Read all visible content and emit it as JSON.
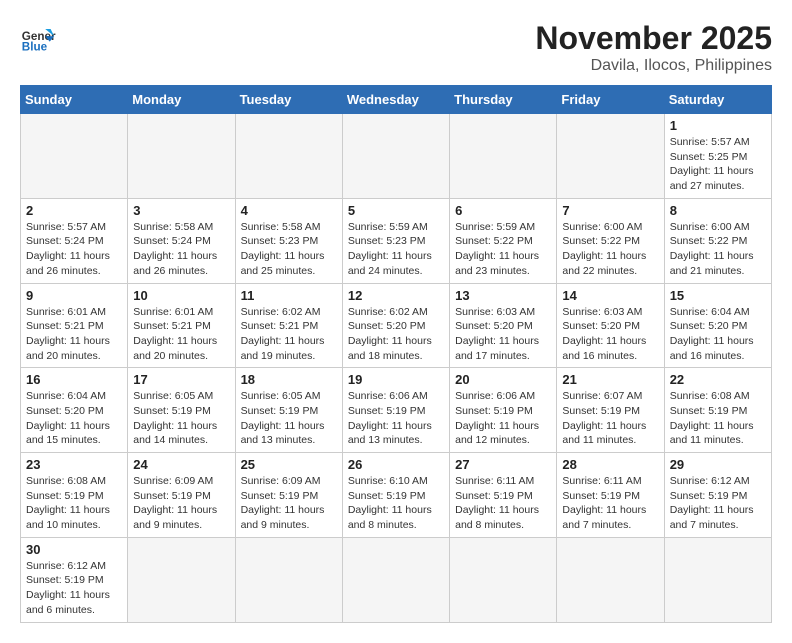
{
  "header": {
    "logo_general": "General",
    "logo_blue": "Blue",
    "month": "November 2025",
    "location": "Davila, Ilocos, Philippines"
  },
  "weekdays": [
    "Sunday",
    "Monday",
    "Tuesday",
    "Wednesday",
    "Thursday",
    "Friday",
    "Saturday"
  ],
  "weeks": [
    [
      {
        "day": "",
        "info": ""
      },
      {
        "day": "",
        "info": ""
      },
      {
        "day": "",
        "info": ""
      },
      {
        "day": "",
        "info": ""
      },
      {
        "day": "",
        "info": ""
      },
      {
        "day": "",
        "info": ""
      },
      {
        "day": "1",
        "info": "Sunrise: 5:57 AM\nSunset: 5:25 PM\nDaylight: 11 hours and 27 minutes."
      }
    ],
    [
      {
        "day": "2",
        "info": "Sunrise: 5:57 AM\nSunset: 5:24 PM\nDaylight: 11 hours and 26 minutes."
      },
      {
        "day": "3",
        "info": "Sunrise: 5:58 AM\nSunset: 5:24 PM\nDaylight: 11 hours and 26 minutes."
      },
      {
        "day": "4",
        "info": "Sunrise: 5:58 AM\nSunset: 5:23 PM\nDaylight: 11 hours and 25 minutes."
      },
      {
        "day": "5",
        "info": "Sunrise: 5:59 AM\nSunset: 5:23 PM\nDaylight: 11 hours and 24 minutes."
      },
      {
        "day": "6",
        "info": "Sunrise: 5:59 AM\nSunset: 5:22 PM\nDaylight: 11 hours and 23 minutes."
      },
      {
        "day": "7",
        "info": "Sunrise: 6:00 AM\nSunset: 5:22 PM\nDaylight: 11 hours and 22 minutes."
      },
      {
        "day": "8",
        "info": "Sunrise: 6:00 AM\nSunset: 5:22 PM\nDaylight: 11 hours and 21 minutes."
      }
    ],
    [
      {
        "day": "9",
        "info": "Sunrise: 6:01 AM\nSunset: 5:21 PM\nDaylight: 11 hours and 20 minutes."
      },
      {
        "day": "10",
        "info": "Sunrise: 6:01 AM\nSunset: 5:21 PM\nDaylight: 11 hours and 20 minutes."
      },
      {
        "day": "11",
        "info": "Sunrise: 6:02 AM\nSunset: 5:21 PM\nDaylight: 11 hours and 19 minutes."
      },
      {
        "day": "12",
        "info": "Sunrise: 6:02 AM\nSunset: 5:20 PM\nDaylight: 11 hours and 18 minutes."
      },
      {
        "day": "13",
        "info": "Sunrise: 6:03 AM\nSunset: 5:20 PM\nDaylight: 11 hours and 17 minutes."
      },
      {
        "day": "14",
        "info": "Sunrise: 6:03 AM\nSunset: 5:20 PM\nDaylight: 11 hours and 16 minutes."
      },
      {
        "day": "15",
        "info": "Sunrise: 6:04 AM\nSunset: 5:20 PM\nDaylight: 11 hours and 16 minutes."
      }
    ],
    [
      {
        "day": "16",
        "info": "Sunrise: 6:04 AM\nSunset: 5:20 PM\nDaylight: 11 hours and 15 minutes."
      },
      {
        "day": "17",
        "info": "Sunrise: 6:05 AM\nSunset: 5:19 PM\nDaylight: 11 hours and 14 minutes."
      },
      {
        "day": "18",
        "info": "Sunrise: 6:05 AM\nSunset: 5:19 PM\nDaylight: 11 hours and 13 minutes."
      },
      {
        "day": "19",
        "info": "Sunrise: 6:06 AM\nSunset: 5:19 PM\nDaylight: 11 hours and 13 minutes."
      },
      {
        "day": "20",
        "info": "Sunrise: 6:06 AM\nSunset: 5:19 PM\nDaylight: 11 hours and 12 minutes."
      },
      {
        "day": "21",
        "info": "Sunrise: 6:07 AM\nSunset: 5:19 PM\nDaylight: 11 hours and 11 minutes."
      },
      {
        "day": "22",
        "info": "Sunrise: 6:08 AM\nSunset: 5:19 PM\nDaylight: 11 hours and 11 minutes."
      }
    ],
    [
      {
        "day": "23",
        "info": "Sunrise: 6:08 AM\nSunset: 5:19 PM\nDaylight: 11 hours and 10 minutes."
      },
      {
        "day": "24",
        "info": "Sunrise: 6:09 AM\nSunset: 5:19 PM\nDaylight: 11 hours and 9 minutes."
      },
      {
        "day": "25",
        "info": "Sunrise: 6:09 AM\nSunset: 5:19 PM\nDaylight: 11 hours and 9 minutes."
      },
      {
        "day": "26",
        "info": "Sunrise: 6:10 AM\nSunset: 5:19 PM\nDaylight: 11 hours and 8 minutes."
      },
      {
        "day": "27",
        "info": "Sunrise: 6:11 AM\nSunset: 5:19 PM\nDaylight: 11 hours and 8 minutes."
      },
      {
        "day": "28",
        "info": "Sunrise: 6:11 AM\nSunset: 5:19 PM\nDaylight: 11 hours and 7 minutes."
      },
      {
        "day": "29",
        "info": "Sunrise: 6:12 AM\nSunset: 5:19 PM\nDaylight: 11 hours and 7 minutes."
      }
    ],
    [
      {
        "day": "30",
        "info": "Sunrise: 6:12 AM\nSunset: 5:19 PM\nDaylight: 11 hours and 6 minutes."
      },
      {
        "day": "",
        "info": ""
      },
      {
        "day": "",
        "info": ""
      },
      {
        "day": "",
        "info": ""
      },
      {
        "day": "",
        "info": ""
      },
      {
        "day": "",
        "info": ""
      },
      {
        "day": "",
        "info": ""
      }
    ]
  ]
}
